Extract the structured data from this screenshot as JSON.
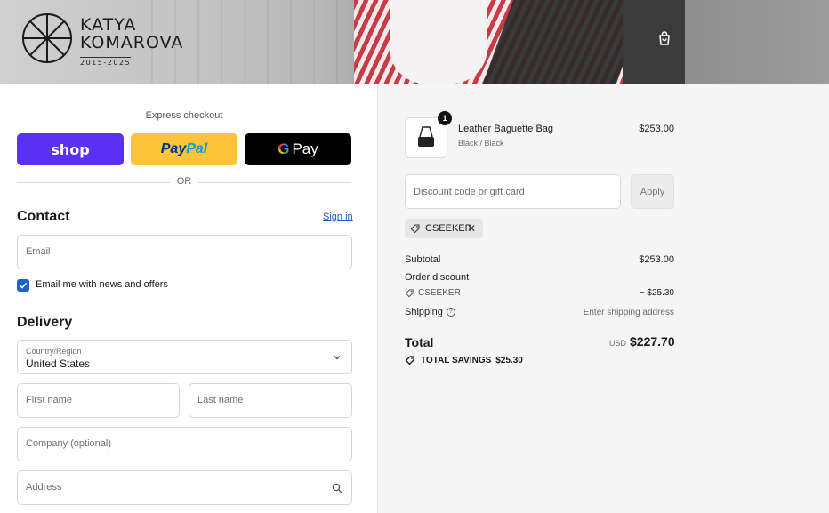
{
  "brand": {
    "line1": "KATYA",
    "line2": "KOMAROVA",
    "years": "2015-2025"
  },
  "express": {
    "title": "Express checkout",
    "shop_label": "shop",
    "paypal_part1": "Pay",
    "paypal_part2": "Pal",
    "gpay_g": "G",
    "gpay_label": "Pay",
    "or_label": "OR"
  },
  "contact": {
    "title": "Contact",
    "signin_label": "Sign in",
    "email_placeholder": "Email",
    "newsletter_label": "Email me with news and offers",
    "newsletter_checked": true
  },
  "delivery": {
    "title": "Delivery",
    "country_label": "Country/Region",
    "country_value": "United States",
    "first_name_placeholder": "First name",
    "last_name_placeholder": "Last name",
    "company_placeholder": "Company (optional)",
    "address_placeholder": "Address"
  },
  "order": {
    "item": {
      "name": "Leather Baguette Bag",
      "variant": "Black / Black",
      "price": "$253.00",
      "quantity": "1"
    },
    "discount_placeholder": "Discount code or gift card",
    "apply_label": "Apply",
    "applied_code": "CSEEKER",
    "subtotal_label": "Subtotal",
    "subtotal_value": "$253.00",
    "order_discount_label": "Order discount",
    "discount_code": "CSEEKER",
    "discount_value": "− $25.30",
    "shipping_label": "Shipping",
    "shipping_value": "Enter shipping address",
    "total_label": "Total",
    "total_currency": "USD",
    "total_value": "$227.70",
    "savings_label": "TOTAL SAVINGS",
    "savings_value": "$25.30"
  },
  "colors": {
    "shop": "#5a31f4",
    "paypal": "#ffc439",
    "gpay": "#000000",
    "link": "#1f5fbf",
    "checkbox": "#1e63c6"
  }
}
